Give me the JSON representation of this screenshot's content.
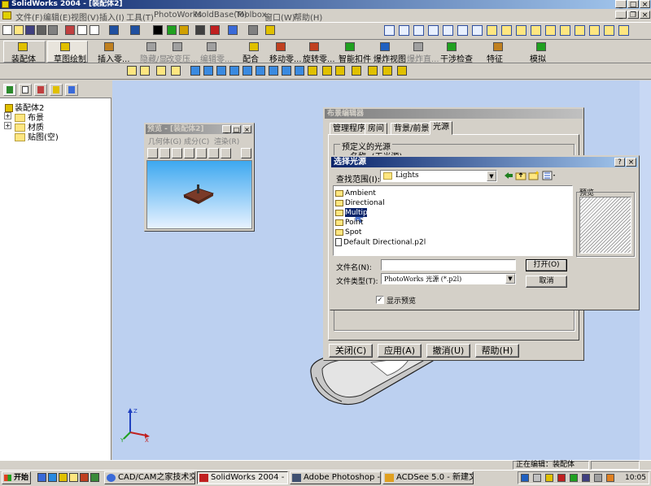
{
  "app": {
    "title": "SolidWorks 2004 - [装配体2]"
  },
  "menu": {
    "items": [
      "文件(F)",
      "编辑(E)",
      "视图(V)",
      "插入(I)",
      "工具(T)",
      "PhotoWorks",
      "MoldBase(M)",
      "Toolbox",
      "窗口(W)",
      "帮助(H)"
    ]
  },
  "toolbar": {
    "tools": [
      "装配体",
      "草图绘制",
      "插入零...",
      "隐藏/显...",
      "改变压...",
      "编辑零...",
      "配合",
      "移动零...",
      "旋转零...",
      "智能扣件",
      "爆炸视图",
      "爆炸直...",
      "干涉检查",
      "特征",
      "模拟"
    ]
  },
  "tree": {
    "root": "装配体2",
    "items": [
      "布景",
      "材质",
      "贴图(空)"
    ]
  },
  "preview_window": {
    "title": "预览 - [装配体2]",
    "menu": [
      "几何体(G)",
      "成分(C)",
      "渲染(R)"
    ]
  },
  "scene_editor": {
    "title": "布景编辑器",
    "tabs": [
      "管理程序",
      "房间",
      "背景/前景",
      "光源"
    ],
    "group_label": "预定义的光源",
    "name_row": "名称:  (无光源)",
    "buttons": [
      "关闭(C)",
      "应用(A)",
      "撤消(U)",
      "帮助(H)"
    ]
  },
  "file_dialog": {
    "title": "选择光源",
    "lookin_label": "查找范围(I):",
    "lookin_value": "Lights",
    "files": [
      "Ambient",
      "Directional",
      "Multiple",
      "Point",
      "Spot",
      "Default Directional.p2l"
    ],
    "selected_index": 2,
    "preview_label": "预览",
    "filename_label": "文件名(N):",
    "filename_value": "",
    "filetype_label": "文件类型(T):",
    "filetype_value": "PhotoWorks 光源 (*.p2l)",
    "open_button": "打开(O)",
    "cancel_button": "取消",
    "show_preview_label": "显示预览",
    "show_preview_checked": true
  },
  "status": {
    "text": "正在编辑：装配体"
  },
  "taskbar": {
    "start": "开始",
    "tasks": [
      "CAD/CAM之家技术交流...",
      "SolidWorks 2004 - [装配...",
      "Adobe Photoshop - [未标...",
      "ACDSee 5.0 - 新建文件夹"
    ],
    "clock": "10:05"
  },
  "colors": {
    "viewport": "#bcd0f0",
    "titlebar_active": "#0a246a",
    "preview_top": "#3da8f0",
    "preview_bottom": "#e8f2ff"
  }
}
